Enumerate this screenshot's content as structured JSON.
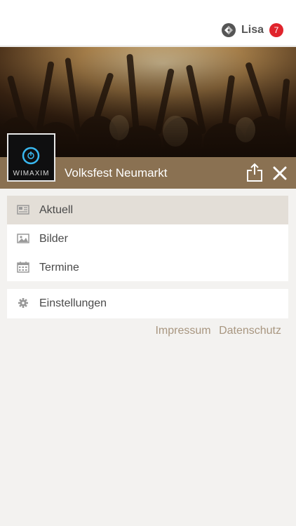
{
  "header": {
    "user_name": "Lisa",
    "notification_count": "7"
  },
  "event": {
    "title": "Volksfest Neumarkt",
    "avatar_brand": "WIMAXIM"
  },
  "menu": {
    "main_items": [
      {
        "label": "Aktuell",
        "icon": "newspaper-icon",
        "active": true
      },
      {
        "label": "Bilder",
        "icon": "image-icon",
        "active": false
      },
      {
        "label": "Termine",
        "icon": "calendar-icon",
        "active": false
      }
    ],
    "settings_item": {
      "label": "Einstellungen",
      "icon": "gear-icon"
    }
  },
  "footer": {
    "impressum": "Impressum",
    "datenschutz": "Datenschutz"
  },
  "colors": {
    "accent_brown": "#8a7152",
    "active_row": "#e3ded7",
    "badge_red": "#e0242c",
    "link_color": "#a89680"
  }
}
